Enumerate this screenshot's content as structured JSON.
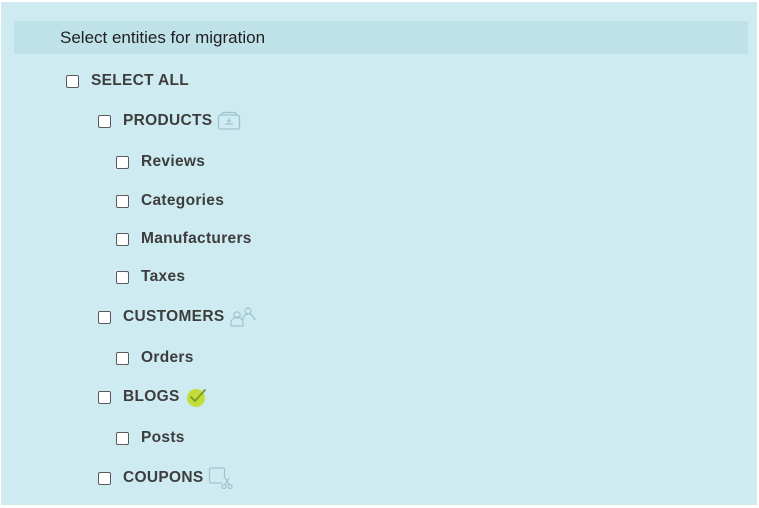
{
  "panel": {
    "title": "Select entities for migration"
  },
  "select_all": {
    "label": "SELECT ALL",
    "checked": false
  },
  "groups": [
    {
      "label": "PRODUCTS",
      "icon": "box-icon",
      "checked": false,
      "children": [
        {
          "label": "Reviews",
          "checked": false
        },
        {
          "label": "Categories",
          "checked": false
        },
        {
          "label": "Manufacturers",
          "checked": false
        },
        {
          "label": "Taxes",
          "checked": false
        }
      ]
    },
    {
      "label": "CUSTOMERS",
      "icon": "users-icon",
      "checked": false,
      "children": [
        {
          "label": "Orders",
          "checked": false
        }
      ]
    },
    {
      "label": "BLOGS",
      "icon": "check-badge-icon",
      "checked": false,
      "children": [
        {
          "label": "Posts",
          "checked": false
        }
      ]
    },
    {
      "label": "COUPONS",
      "icon": "coupon-scissors-icon",
      "checked": false,
      "children": []
    }
  ],
  "colors": {
    "panel_bg": "#cdebf0",
    "header_bg": "#bfe1e8",
    "icon_outline": "#9fc3cc",
    "check_badge": "#c3de3a"
  }
}
